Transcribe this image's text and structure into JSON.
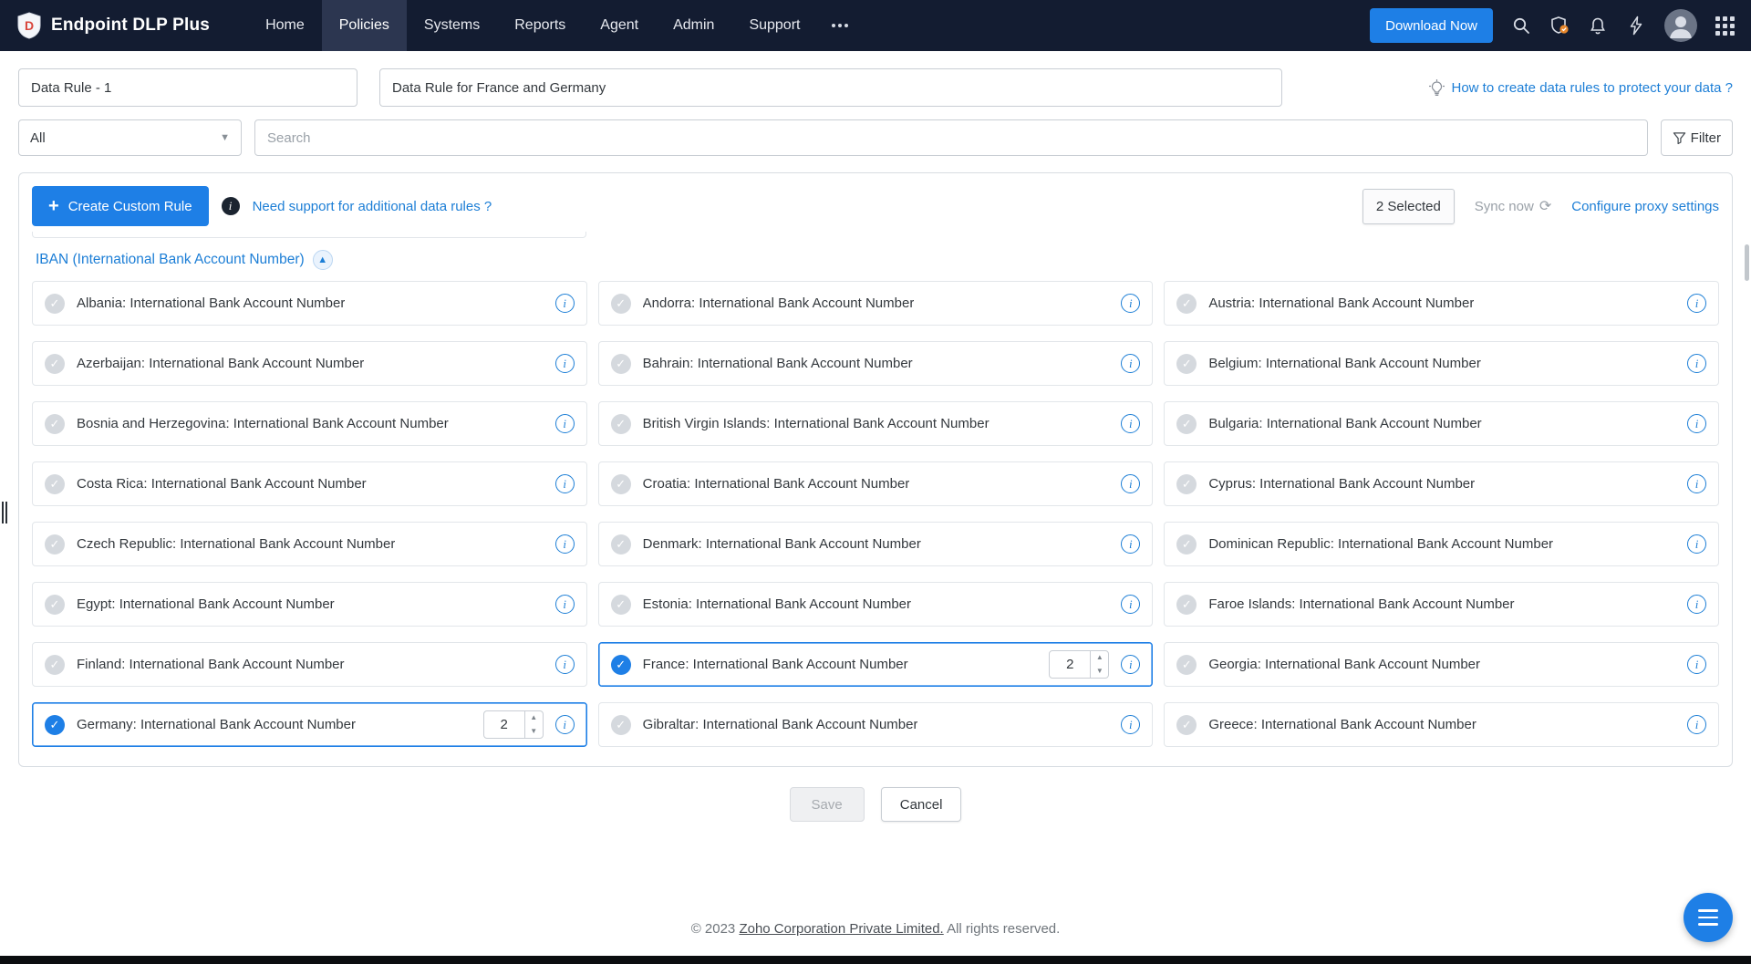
{
  "nav": {
    "brand": "Endpoint DLP Plus",
    "items": [
      {
        "label": "Home",
        "active": false
      },
      {
        "label": "Policies",
        "active": true
      },
      {
        "label": "Systems",
        "active": false
      },
      {
        "label": "Reports",
        "active": false
      },
      {
        "label": "Agent",
        "active": false
      },
      {
        "label": "Admin",
        "active": false
      },
      {
        "label": "Support",
        "active": false
      }
    ],
    "download_label": "Download Now",
    "icons": {
      "search": "magnifier",
      "security_alert": "shield-with-orange-badge",
      "notifications": "bell",
      "quick_actions": "lightning-bolt",
      "apps": "grid-3x3",
      "avatar": "user-photo-placeholder"
    }
  },
  "rule_header": {
    "name_value": "Data Rule - 1",
    "description_value": "Data Rule for France and Germany",
    "help_link": "How to create data rules to protect your data ?"
  },
  "filter_bar": {
    "category_value": "All",
    "search_placeholder": "Search",
    "filter_label": "Filter"
  },
  "toolbar": {
    "create_label": "Create Custom Rule",
    "support_link": "Need support for additional data rules ?",
    "selected_label": "2 Selected",
    "sync_label": "Sync now",
    "proxy_label": "Configure proxy settings"
  },
  "section": {
    "title": "IBAN (International Bank Account Number)"
  },
  "cards": [
    {
      "label": "Albania: International Bank Account Number",
      "selected": false,
      "count": null
    },
    {
      "label": "Andorra: International Bank Account Number",
      "selected": false,
      "count": null
    },
    {
      "label": "Austria: International Bank Account Number",
      "selected": false,
      "count": null
    },
    {
      "label": "Azerbaijan: International Bank Account Number",
      "selected": false,
      "count": null
    },
    {
      "label": "Bahrain: International Bank Account Number",
      "selected": false,
      "count": null
    },
    {
      "label": "Belgium: International Bank Account Number",
      "selected": false,
      "count": null
    },
    {
      "label": "Bosnia and Herzegovina: International Bank Account Number",
      "selected": false,
      "count": null
    },
    {
      "label": "British Virgin Islands: International Bank Account Number",
      "selected": false,
      "count": null
    },
    {
      "label": "Bulgaria: International Bank Account Number",
      "selected": false,
      "count": null
    },
    {
      "label": "Costa Rica: International Bank Account Number",
      "selected": false,
      "count": null
    },
    {
      "label": "Croatia: International Bank Account Number",
      "selected": false,
      "count": null
    },
    {
      "label": "Cyprus: International Bank Account Number",
      "selected": false,
      "count": null
    },
    {
      "label": "Czech Republic: International Bank Account Number",
      "selected": false,
      "count": null
    },
    {
      "label": "Denmark: International Bank Account Number",
      "selected": false,
      "count": null
    },
    {
      "label": "Dominican Republic: International Bank Account Number",
      "selected": false,
      "count": null
    },
    {
      "label": "Egypt: International Bank Account Number",
      "selected": false,
      "count": null
    },
    {
      "label": "Estonia: International Bank Account Number",
      "selected": false,
      "count": null
    },
    {
      "label": "Faroe Islands: International Bank Account Number",
      "selected": false,
      "count": null
    },
    {
      "label": "Finland: International Bank Account Number",
      "selected": false,
      "count": null
    },
    {
      "label": "France: International Bank Account Number",
      "selected": true,
      "count": "2"
    },
    {
      "label": "Georgia: International Bank Account Number",
      "selected": false,
      "count": null
    },
    {
      "label": "Germany: International Bank Account Number",
      "selected": true,
      "count": "2"
    },
    {
      "label": "Gibraltar: International Bank Account Number",
      "selected": false,
      "count": null
    },
    {
      "label": "Greece: International Bank Account Number",
      "selected": false,
      "count": null
    }
  ],
  "actions": {
    "save_label": "Save",
    "cancel_label": "Cancel"
  },
  "footer": {
    "prefix": "© 2023",
    "link": "Zoho Corporation Private Limited.",
    "suffix": "All rights reserved."
  },
  "colors": {
    "nav_bg": "#131c31",
    "accent_blue": "#1e7fe6",
    "link_blue": "#1c7ed6",
    "card_border": "#e2e6ea",
    "check_gray": "#d5d9de"
  }
}
